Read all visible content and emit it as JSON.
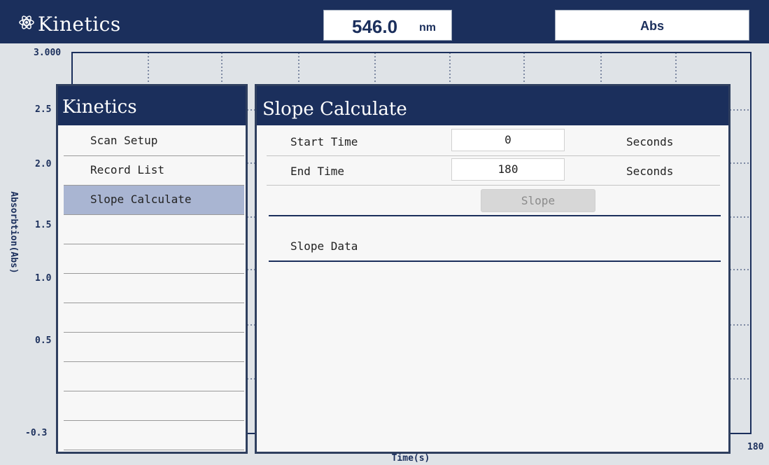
{
  "app": {
    "title": "Kinetics",
    "icon": "atom-icon"
  },
  "header": {
    "wavelength_value": "546.0",
    "wavelength_unit": "nm",
    "mode": "Abs"
  },
  "chart_data": {
    "type": "line",
    "ylabel": "Absorbtion(Abs)",
    "xlabel": "Time(s)",
    "y_ticks": [
      "3.000",
      "2.5",
      "2.0",
      "1.5",
      "1.0",
      "0.5",
      "-0.3"
    ],
    "x_end_label": "180",
    "ylim": [
      -0.3,
      3.0
    ],
    "xlim": [
      0,
      180
    ],
    "grid": true,
    "series": []
  },
  "side_panel": {
    "title": "Kinetics",
    "items": [
      {
        "label": "Scan Setup"
      },
      {
        "label": "Record List"
      },
      {
        "label": "Slope Calculate",
        "active": true
      },
      {
        "label": ""
      },
      {
        "label": ""
      },
      {
        "label": ""
      },
      {
        "label": ""
      },
      {
        "label": ""
      },
      {
        "label": ""
      },
      {
        "label": ""
      },
      {
        "label": ""
      }
    ]
  },
  "main_panel": {
    "title": "Slope Calculate",
    "start_time": {
      "label": "Start Time",
      "value": "0",
      "unit": "Seconds"
    },
    "end_time": {
      "label": "End Time",
      "value": "180",
      "unit": "Seconds"
    },
    "slope_button": "Slope",
    "slope_data_label": "Slope Data"
  },
  "colors": {
    "header_bg": "#1b2f5c",
    "active_item": "#a9b5d2",
    "panel_bg": "#f7f7f7"
  }
}
